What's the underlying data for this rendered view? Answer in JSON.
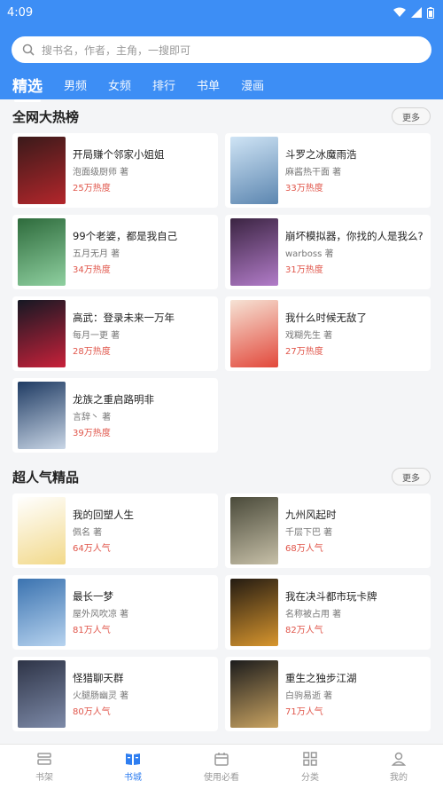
{
  "status": {
    "time": "4:09"
  },
  "search": {
    "placeholder": "搜书名，作者，主角，一搜即可"
  },
  "tabs": [
    "精选",
    "男频",
    "女频",
    "排行",
    "书单",
    "漫画"
  ],
  "sections": [
    {
      "title": "全网大热榜",
      "more": "更多",
      "books": [
        {
          "title": "开局赚个邻家小姐姐",
          "author": "泡面级厨师 著",
          "stat": "25万热度",
          "cover": [
            "#3a1a1a",
            "#b3262b"
          ],
          "cover_text": ""
        },
        {
          "title": "斗罗之冰魔雨浩",
          "author": "麻酱热干面 著",
          "stat": "33万热度",
          "cover": [
            "#cfe4f5",
            "#5c86b0"
          ],
          "cover_text": ""
        },
        {
          "title": "99个老婆，都是我自己",
          "author": "五月无月 著",
          "stat": "34万热度",
          "cover": [
            "#2e6b3c",
            "#8fd0a0"
          ],
          "cover_text": ""
        },
        {
          "title": "崩坏模拟器，你找的人是我么?",
          "author": "warboss 著",
          "stat": "31万热度",
          "cover": [
            "#3b2442",
            "#b27cc9"
          ],
          "cover_text": ""
        },
        {
          "title": "高武：登录未来一万年",
          "author": "每月一更 著",
          "stat": "28万热度",
          "cover": [
            "#151823",
            "#c8213a"
          ],
          "cover_text": ""
        },
        {
          "title": "我什么时候无敌了",
          "author": "戏糊先生 著",
          "stat": "27万热度",
          "cover": [
            "#f6e3d5",
            "#e2483b"
          ],
          "cover_text": ""
        },
        {
          "title": "龙族之重启路明非",
          "author": "言辞丶 著",
          "stat": "39万热度",
          "cover": [
            "#1f3b63",
            "#c9d6e6"
          ],
          "cover_text": ""
        }
      ]
    },
    {
      "title": "超人气精品",
      "more": "更多",
      "books": [
        {
          "title": "我的回塑人生",
          "author": "佩名 著",
          "stat": "64万人气",
          "cover": [
            "#ffffff",
            "#f2d98a"
          ],
          "cover_text": ""
        },
        {
          "title": "九州风起时",
          "author": "千层下巴 著",
          "stat": "68万人气",
          "cover": [
            "#4a4a3a",
            "#c7c0a8"
          ],
          "cover_text": ""
        },
        {
          "title": "最长一梦",
          "author": "屋外风吹凉 著",
          "stat": "81万人气",
          "cover": [
            "#3b73b0",
            "#b7d3ef"
          ],
          "cover_text": ""
        },
        {
          "title": "我在决斗都市玩卡牌",
          "author": "名称被占用 著",
          "stat": "82万人气",
          "cover": [
            "#241b12",
            "#d8962e"
          ],
          "cover_text": ""
        },
        {
          "title": "怪猎聊天群",
          "author": "火腿肠幽灵 著",
          "stat": "80万人气",
          "cover": [
            "#2e3447",
            "#7d8aa8"
          ],
          "cover_text": ""
        },
        {
          "title": "重生之独步江湖",
          "author": "白驹易逝 著",
          "stat": "71万人气",
          "cover": [
            "#1c1c1c",
            "#caa462"
          ],
          "cover_text": ""
        }
      ]
    }
  ],
  "nav": [
    {
      "label": "书架",
      "icon": "bookshelf-icon",
      "active": false
    },
    {
      "label": "书城",
      "icon": "book-icon",
      "active": true
    },
    {
      "label": "使用必看",
      "icon": "calendar-icon",
      "active": false
    },
    {
      "label": "分类",
      "icon": "grid-icon",
      "active": false
    },
    {
      "label": "我的",
      "icon": "user-icon",
      "active": false
    }
  ],
  "colors": {
    "primary": "#3d8ef5",
    "stat": "#e0554a",
    "nav_active": "#2f7ef0"
  }
}
